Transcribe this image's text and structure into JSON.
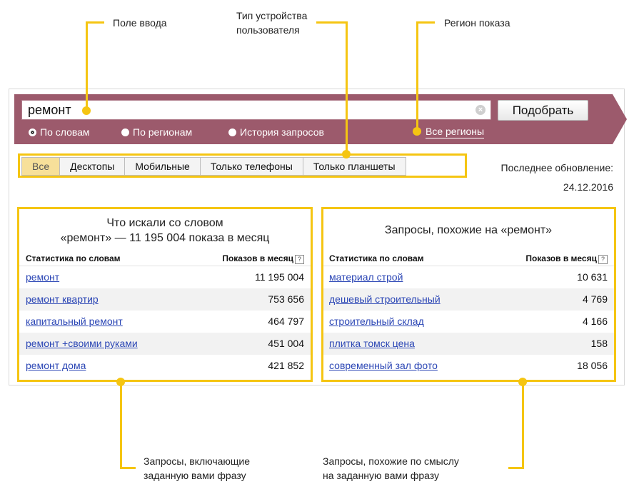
{
  "callouts": {
    "input": "Поле ввода",
    "device_line1": "Тип устройства",
    "device_line2": "пользователя",
    "region": "Регион показа",
    "left_line1": "Запросы, включающие",
    "left_line2": "заданную вами фразу",
    "right_line1": "Запросы, похожие по смыслу",
    "right_line2": "на заданную вами фразу"
  },
  "search": {
    "value": "ремонт",
    "submit_label": "Подобрать",
    "modes": [
      "По словам",
      "По регионам",
      "История запросов"
    ],
    "selected_mode": "По словам",
    "region_label": "Все регионы"
  },
  "tabs": {
    "items": [
      "Все",
      "Десктопы",
      "Мобильные",
      "Только телефоны",
      "Только планшеты"
    ],
    "active": "Все"
  },
  "update": {
    "label": "Последнее обновление:",
    "date": "24.12.2016"
  },
  "left_panel": {
    "title_line1": "Что искали со словом",
    "title_line2": "«ремонт» — 11 195 004 показа в месяц",
    "col_phrase": "Статистика по словам",
    "col_shows": "Показов в месяц",
    "help_icon": "?",
    "rows": [
      {
        "phrase": "ремонт",
        "shows": "11 195 004"
      },
      {
        "phrase": "ремонт квартир",
        "shows": "753 656"
      },
      {
        "phrase": "капитальный ремонт",
        "shows": "464 797"
      },
      {
        "phrase": "ремонт +своими руками",
        "shows": "451 004"
      },
      {
        "phrase": "ремонт дома",
        "shows": "421 852"
      }
    ]
  },
  "right_panel": {
    "title": "Запросы, похожие на «ремонт»",
    "col_phrase": "Статистика по словам",
    "col_shows": "Показов в месяц",
    "help_icon": "?",
    "rows": [
      {
        "phrase": "материал строй",
        "shows": "10 631"
      },
      {
        "phrase": "дешевый строительный",
        "shows": "4 769"
      },
      {
        "phrase": "строительный склад",
        "shows": "4 166"
      },
      {
        "phrase": "плитка томск цена",
        "shows": "158"
      },
      {
        "phrase": "современный зал фото",
        "shows": "18 056"
      }
    ]
  },
  "colors": {
    "bar": "#9c5a6c",
    "annotation": "#f5c512",
    "link": "#2b46b5",
    "active_tab": "#f7e09a"
  }
}
